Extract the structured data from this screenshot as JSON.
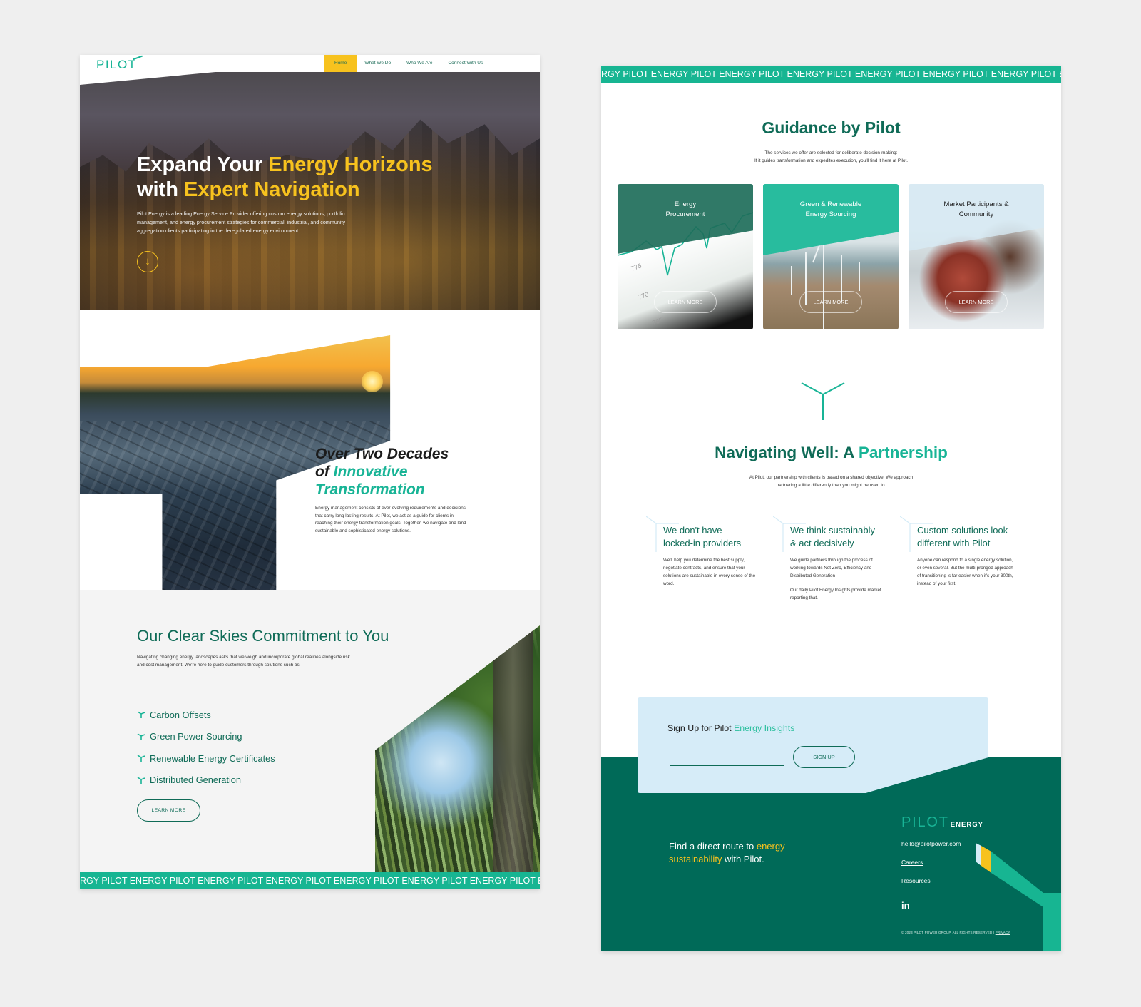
{
  "left_page": {
    "nav": {
      "logo": "PILOT",
      "items": [
        {
          "label": "Home",
          "active": true
        },
        {
          "label": "What We Do",
          "active": false
        },
        {
          "label": "Who We Are",
          "active": false
        },
        {
          "label": "Connect  With Us",
          "active": false
        }
      ]
    },
    "hero": {
      "title_line1_plain": "Expand Your ",
      "title_line1_highlight": "Energy Horizons",
      "title_line2_plain": "with ",
      "title_line2_highlight": "Expert Navigation",
      "body": "Pilot Energy is a leading Energy Service Provider offering custom energy solutions, portfolio management, and energy procurement strategies for commercial, industrial, and community aggregation clients participating in the deregulated energy environment.",
      "scroll_icon": "arrow-down-circle-icon"
    },
    "decades": {
      "title_line1": "Over Two Decades",
      "title_line2_plain": "of ",
      "title_line2_highlight": "Innovative",
      "title_line3_highlight": "Transformation",
      "body": "Energy management consists of ever-evolving requirements and decisions that carry long lasting results. At Pilot, we act as a guide for clients in reaching their energy transformation goals. Together, we navigate and land sustainable and sophisticated energy solutions."
    },
    "skies": {
      "title": "Our Clear Skies Commitment to You",
      "body": "Navigating changing energy landscapes asks that we weigh and incorporate global realities alongside risk and cost management. We're here to guide customers through solutions such as:",
      "list": [
        "Carbon Offsets",
        "Green Power Sourcing",
        "Renewable Energy Certificates",
        "Distributed Generation"
      ],
      "list_icon": "pilot-y-icon",
      "cta": "LEARN MORE"
    },
    "marquee": "RGY PILOT ENERGY PILOT ENERGY PILOT ENERGY PILOT ENERGY PILOT ENERGY PILOT ENERGY PILOT ENERGY PILOT"
  },
  "right_page": {
    "marquee": "RGY PILOT ENERGY PILOT ENERGY PILOT ENERGY PILOT ENERGY PILOT ENERGY PILOT ENERGY PILOT ENERGY PILOT",
    "guidance": {
      "title": "Guidance by Pilot",
      "sub_line1": "The services we offer are selected for deliberate decision-making:",
      "sub_line2": "If it guides transformation and expedites execution, you'll find it here at Pilot.",
      "cards": [
        {
          "title_line1": "Energy",
          "title_line2": "Procurement",
          "cta": "LEARN MORE"
        },
        {
          "title_line1": "Green & Renewable",
          "title_line2": "Energy Sourcing",
          "cta": "LEARN MORE"
        },
        {
          "title_line1": "Market Participants &",
          "title_line2": "Community",
          "cta": "LEARN MORE"
        }
      ]
    },
    "partnership": {
      "title_plain": "Navigating Well: A ",
      "title_highlight": "Partnership",
      "sub_line1": "At Pilot, our partnership with clients is based on a shared objective. We approach",
      "sub_line2": "partnering a little differently than you might be used to.",
      "pillars": [
        {
          "title_line1": "We don't have",
          "title_line2": "locked-in providers",
          "body": "We'll help you determine the best supply, negotiate contracts, and ensure that your solutions are sustainable in every sense of the word.",
          "body2": ""
        },
        {
          "title_line1": "We think sustainably",
          "title_line2": "& act decisively",
          "body": "We guide partners through the process of working towards Net Zero, Efficiency and Distributed Generation",
          "body2": "Our daily Pilot Energy Insights provide market reporting that."
        },
        {
          "title_line1": "Custom solutions look",
          "title_line2": "different with Pilot",
          "body": "Anyone can respond to a single energy solution, or even several. But the multi-pronged approach of transitioning is far easier when it's your 300th, instead of your first.",
          "body2": ""
        }
      ]
    },
    "signup": {
      "title_plain": "Sign Up for Pilot ",
      "title_highlight": "Energy Insights",
      "input_value": "",
      "input_placeholder": "",
      "button": "SIGN UP"
    },
    "footer": {
      "tagline_plain1": "Find a direct route to ",
      "tagline_highlight1": "energy",
      "tagline_highlight2": "sustainability",
      "tagline_plain2": " with Pilot.",
      "logo_main": "PILOT",
      "logo_sub": "ENERGY",
      "links": [
        "hello@pilotpower.com",
        "Careers",
        "Resources"
      ],
      "social_icon": "linkedin-icon",
      "social_label": "in",
      "copyright": "© 2023 PILOT POWER GROUP. ALL RIGHTS RESERVED  |  ",
      "privacy": "PRIVACY"
    }
  },
  "colors": {
    "brand_green": "#0f6b57",
    "teal": "#18b496",
    "footer_green": "#006a58",
    "yellow": "#f7c21e",
    "light_blue": "#d6ecf8",
    "background": "#efefef"
  }
}
